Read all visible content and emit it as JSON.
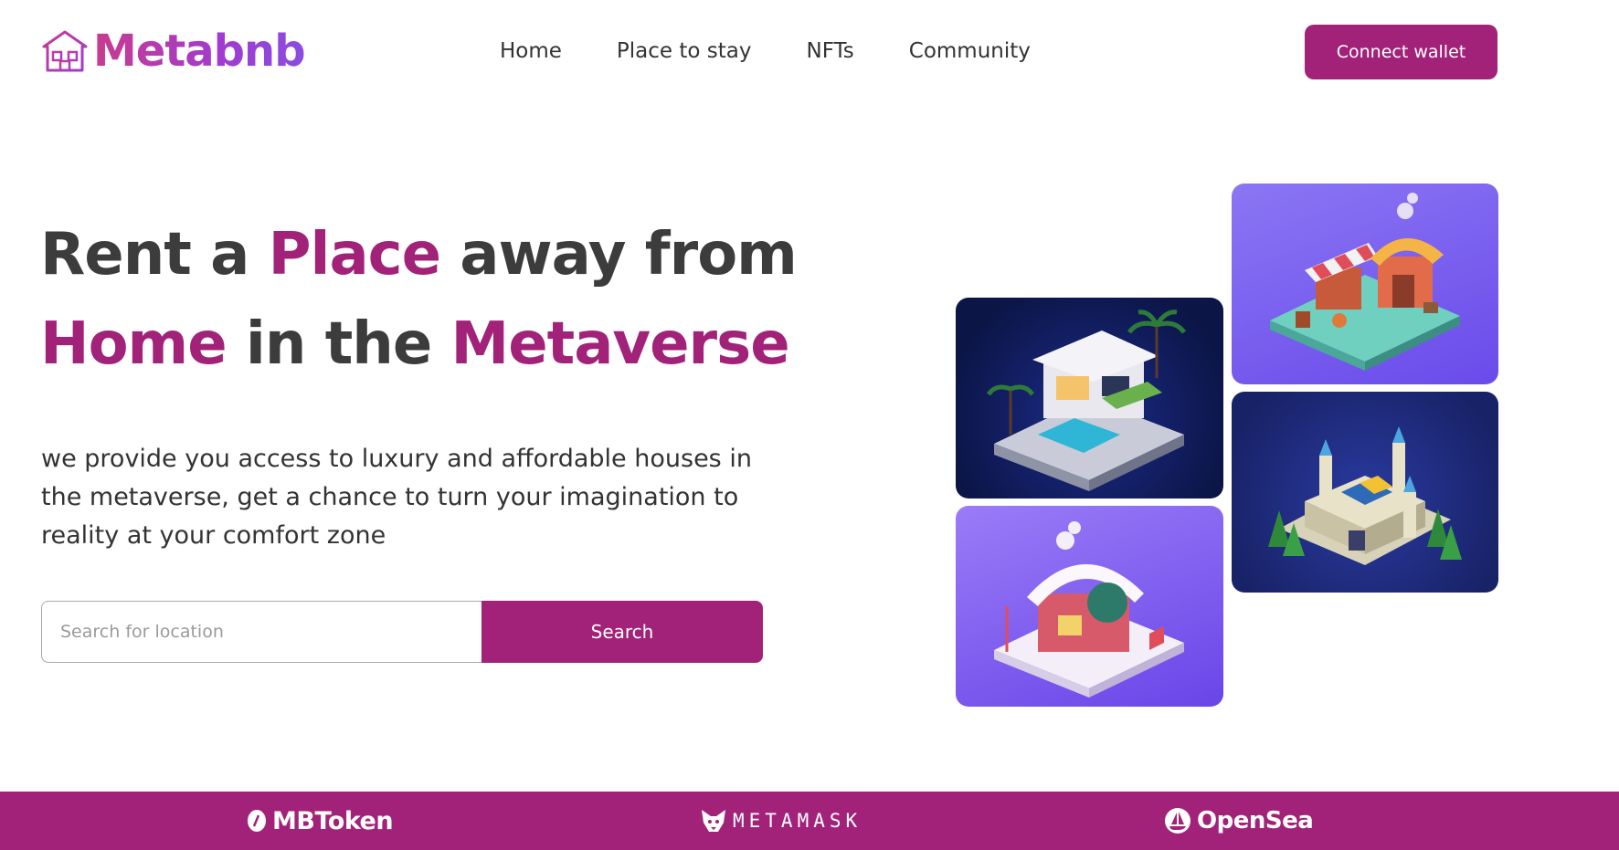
{
  "brand": {
    "name": "Metabnb",
    "icon": "house-icon"
  },
  "nav": {
    "items": [
      {
        "label": "Home"
      },
      {
        "label": "Place to stay"
      },
      {
        "label": "NFTs"
      },
      {
        "label": "Community"
      }
    ]
  },
  "header": {
    "connect_label": "Connect wallet"
  },
  "hero": {
    "title_parts": {
      "p1": "Rent a ",
      "p2": "Place",
      "p3": " away from",
      "p4": "Home",
      "p5": " in the ",
      "p6": "Metaverse"
    },
    "description": "we provide you access to luxury and affordable houses in the metaverse, get a chance to turn your imagination to reality at your comfort zone"
  },
  "search": {
    "placeholder": "Search for location",
    "button_label": "Search"
  },
  "gallery": [
    {
      "icon": "market-stall-image"
    },
    {
      "icon": "villa-image"
    },
    {
      "icon": "castle-image"
    },
    {
      "icon": "snow-house-image"
    }
  ],
  "partners": [
    {
      "name": "MBToken",
      "icon": "mbtoken-icon"
    },
    {
      "name": "METAMASK",
      "icon": "fox-icon"
    },
    {
      "name": "OpenSea",
      "icon": "opensea-icon"
    }
  ],
  "colors": {
    "accent": "#a12278",
    "logo_gradient_start": "#c93b8e",
    "logo_gradient_end": "#8a4de0",
    "text": "#333333"
  }
}
